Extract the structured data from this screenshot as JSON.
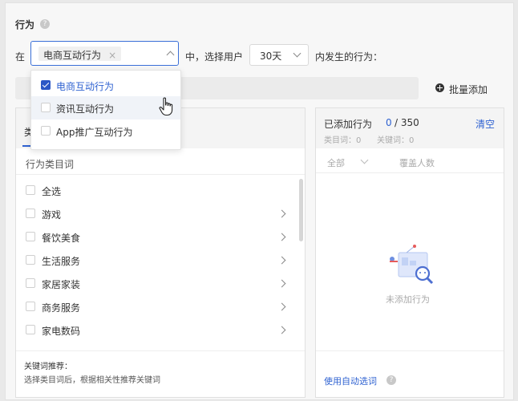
{
  "behavior": {
    "title": "行为",
    "help_icon": "?",
    "prefix": "在",
    "selected_tag": "电商互动行为",
    "tag_remove": "×",
    "middle_text": "中，选择用户",
    "days_value": "30天",
    "suffix": "内发生的行为："
  },
  "dropdown": {
    "options": [
      {
        "label": "电商互动行为",
        "checked": true
      },
      {
        "label": "资讯互动行为",
        "checked": false
      },
      {
        "label": "App推广互动行为",
        "checked": false
      }
    ]
  },
  "batch_add": {
    "label": "批量添加"
  },
  "left_panel": {
    "tab_fragment": "类",
    "header": "行为类目词",
    "items": [
      {
        "label": "全选",
        "has_children": false
      },
      {
        "label": "游戏",
        "has_children": true
      },
      {
        "label": "餐饮美食",
        "has_children": true
      },
      {
        "label": "生活服务",
        "has_children": true
      },
      {
        "label": "家居家装",
        "has_children": true
      },
      {
        "label": "商务服务",
        "has_children": true
      },
      {
        "label": "家电数码",
        "has_children": true
      }
    ],
    "footer_title": "关键词推荐：",
    "footer_desc": "选择类目词后，根据相关性推荐关键词"
  },
  "right_panel": {
    "added_label": "已添加行为",
    "added_count": "0",
    "added_total": "/ 350",
    "clear": "清空",
    "category_count": "类目词：0",
    "keyword_count": "关键词：0",
    "filter_all": "全部",
    "coverage": "覆盖人数",
    "empty_text": "未添加行为",
    "auto_select": "使用自动选词"
  },
  "colors": {
    "accent": "#2f62d1",
    "checkbox_on": "#2b57c6"
  }
}
